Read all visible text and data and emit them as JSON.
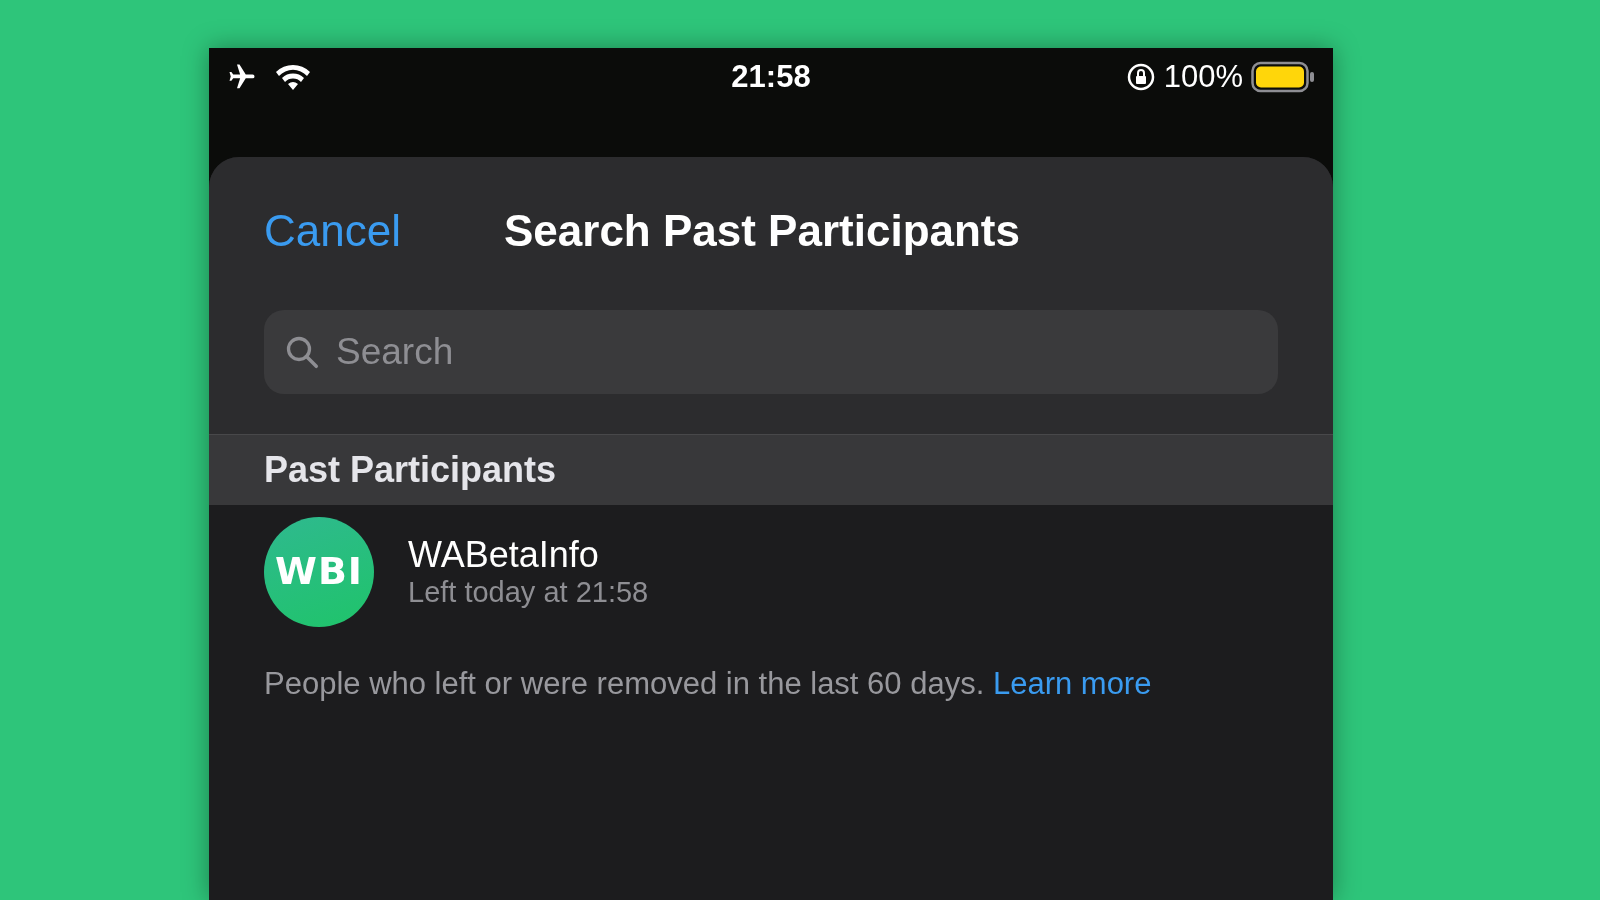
{
  "status_bar": {
    "time": "21:58",
    "battery": "100%"
  },
  "sheet": {
    "cancel": "Cancel",
    "title": "Search Past Participants"
  },
  "search": {
    "placeholder": "Search"
  },
  "section": {
    "title": "Past Participants"
  },
  "participants": [
    {
      "avatar": "WBI",
      "name": "WABetaInfo",
      "subtitle": "Left today at 21:58"
    }
  ],
  "footer": {
    "text": "People who left or were removed in the last 60 days.",
    "link": "Learn more"
  }
}
